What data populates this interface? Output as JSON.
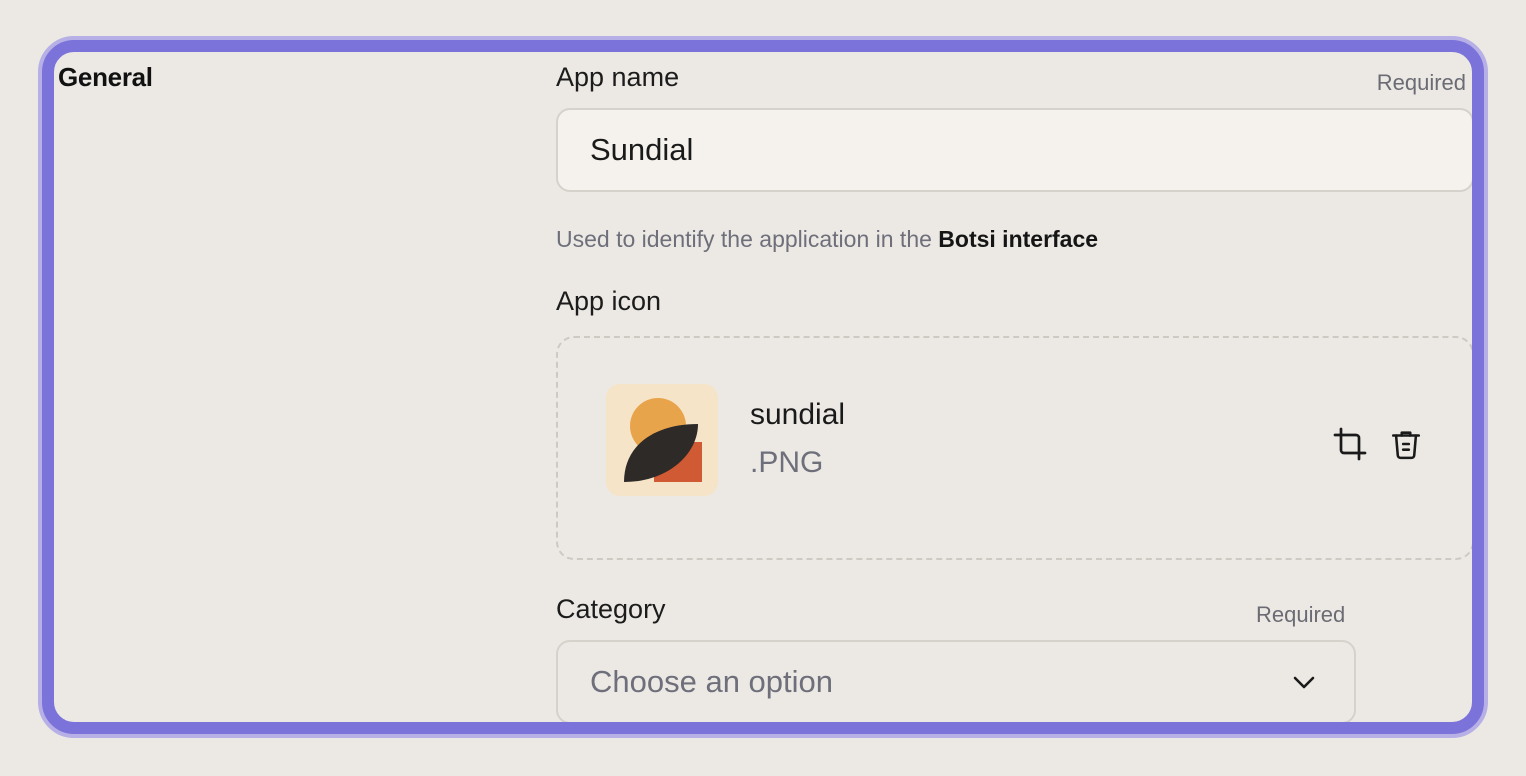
{
  "section": {
    "title": "General"
  },
  "app_name": {
    "label": "App name",
    "required": "Required",
    "value": "Sundial",
    "help_prefix": "Used to identify the application in the ",
    "help_bold": "Botsi interface"
  },
  "app_icon": {
    "label": "App icon",
    "file_name": "sundial",
    "file_ext": ".PNG",
    "actions": {
      "crop_icon": "crop-icon",
      "delete_icon": "trash-icon"
    }
  },
  "category": {
    "label": "Category",
    "required": "Required",
    "placeholder": "Choose an option",
    "icon": "chevron-down-icon"
  },
  "colors": {
    "accent": "#7b73d9",
    "accent_outer": "#b7b0e6",
    "background": "#ece9e4",
    "input_bg": "#f5f1ec"
  }
}
